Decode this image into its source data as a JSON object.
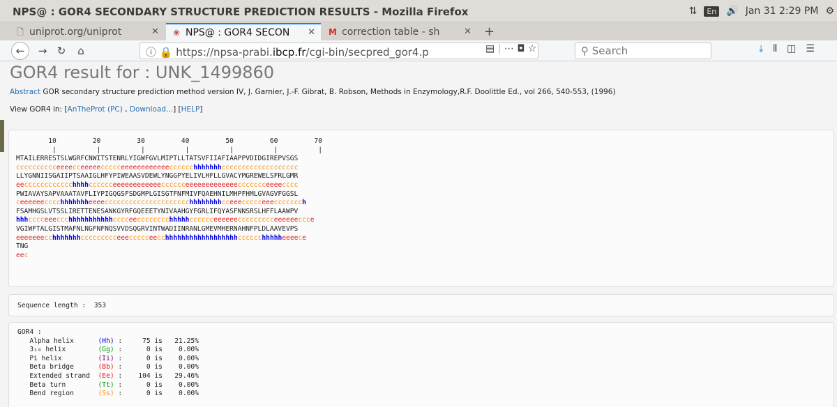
{
  "window": {
    "title": "NPS@ : GOR4 SECONDARY STRUCTURE PREDICTION RESULTS - Mozilla Firefox",
    "keyboard": "En",
    "clock": "Jan 31  2:29 PM"
  },
  "tabs": [
    {
      "label": "uniprot.org/uniprot"
    },
    {
      "label": "NPS@ : GOR4 SECON"
    },
    {
      "label": "correction table - sh"
    }
  ],
  "nav": {
    "url_prefix": "https://npsa-prabi.",
    "url_domain": "ibcp.fr",
    "url_suffix": "/cgi-bin/secpred_gor4.p",
    "search_placeholder": "Search"
  },
  "page": {
    "title": "GOR4 result for : UNK_1499860",
    "abstract_link": "Abstract",
    "abstract_text": " GOR secondary structure prediction method version IV, J. Garnier, J.-F. Gibrat, B. Robson, Methods in Enzymology,R.F. Doolittle Ed., vol 266, 540-553, (1996)",
    "view_prefix": "View GOR4 in: [",
    "view_link1": "AnTheProt (PC)",
    "view_sep": " , ",
    "view_link2": "Download...",
    "view_mid": "] [",
    "view_link3": "HELP",
    "view_end": "]",
    "ruler_numbers": "        10         20         30         40         50         60         70",
    "ruler_ticks": "         |          |          |          |          |          |          |",
    "sequence_lines": [
      "MTAILERRESTSLWGRFCNWITSTENRLYIGWFGVLMIPTLLTATSVFIIAFIAAPPVDIDGIREPVSGS",
      "LLYGNNIISGAIIPTSAAIGLHFYPIWEAASVDEWLYNGGPYELIVLHFLLGVACYMGREWELSFRLGMR",
      "PWIAVAYSAPVAAATAVFLIYPIGQGSFSDGMPLGISGTFNFMIVFQAEHNILMHPFHMLGVAGVFGGSL",
      "FSAMHGSLVTSSLIRETTENESANKGYRFGQEEETYNIVAAHGYFGRLIFQYASFNNSRSLHFFLAAWPV",
      "VGIWFTALGISTMAFNLNGFNFNQSVVDSQGRVINTWADIINRANLGMEVMHERNAHNFPLDLAAVEVPS",
      "TNG"
    ],
    "prediction_lines": [
      "cccccccccceeeecceeeeeccccceeeeeeeeeeeecccccchhhhhhhccccccccccccccccccc",
      "eecccccccccccchhhhcccccceeeeeeeeeeeecccccceeeeeeeeeeeeeccccccceeeecccc",
      "ceeeeeecccchhhhhhheeeeccccccccccccccccccccchhhhhhhhcceeeccccceeeccccccch",
      "hhhcccceeeccchhhhhhhhhhhcccceecccccccchhhhhcccccceeeeeeccccccccceeeeeeccce",
      "eeeeeeecchhhhhhhccccccccceeeccccceecchhhhhhhhhhhhhhhhhhcccccchhhhheeeece",
      "eec"
    ],
    "seq_length_label": "Sequence length : ",
    "seq_length_value": "353",
    "gor_header": "GOR4 :",
    "gor_rows": [
      {
        "name": "Alpha helix",
        "code": "(Hh)",
        "count": "75",
        "pct": "21.25%",
        "color": "#0000dd"
      },
      {
        "name": "3₁₀ helix",
        "code": "(Gg)",
        "count": "0",
        "pct": "0.00%",
        "color": "#00a000"
      },
      {
        "name": "Pi helix",
        "code": "(Ii)",
        "count": "0",
        "pct": "0.00%",
        "color": "#800080"
      },
      {
        "name": "Beta bridge",
        "code": "(Bb)",
        "count": "0",
        "pct": "0.00%",
        "color": "#e41a1c"
      },
      {
        "name": "Extended strand",
        "code": "(Ee)",
        "count": "104",
        "pct": "29.46%",
        "color": "#e41a1c"
      },
      {
        "name": "Beta turn",
        "code": "(Tt)",
        "count": "0",
        "pct": "0.00%",
        "color": "#00a000"
      },
      {
        "name": "Bend region",
        "code": "(Ss)",
        "count": "0",
        "pct": "0.00%",
        "color": "#ff8c00"
      }
    ]
  }
}
